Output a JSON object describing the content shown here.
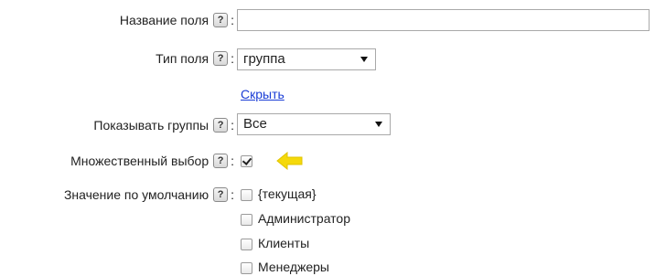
{
  "fields": {
    "field_name": {
      "label": "Название поля",
      "help": "?",
      "colon": ":",
      "value": ""
    },
    "field_type": {
      "label": "Тип поля",
      "help": "?",
      "colon": ":",
      "value": "группа"
    },
    "hide_link": "Скрыть",
    "show_groups": {
      "label": "Показывать группы",
      "help": "?",
      "colon": ":",
      "value": "Все"
    },
    "multiple_choice": {
      "label": "Множественный выбор",
      "help": "?",
      "colon": ":",
      "checked": true
    },
    "default_value": {
      "label": "Значение по умолчанию",
      "help": "?",
      "colon": ":",
      "options": [
        {
          "label": "{текущая}",
          "checked": false
        },
        {
          "label": "Администратор",
          "checked": false
        },
        {
          "label": "Клиенты",
          "checked": false
        },
        {
          "label": "Менеджеры",
          "checked": false
        }
      ]
    }
  },
  "colors": {
    "link": "#1a3dd6",
    "pointer_arrow": "#f5d90a"
  },
  "icons": {
    "help": "help-question-icon",
    "select_arrow": "dropdown-triangle-icon",
    "pointer": "left-arrow-pointer-icon"
  }
}
